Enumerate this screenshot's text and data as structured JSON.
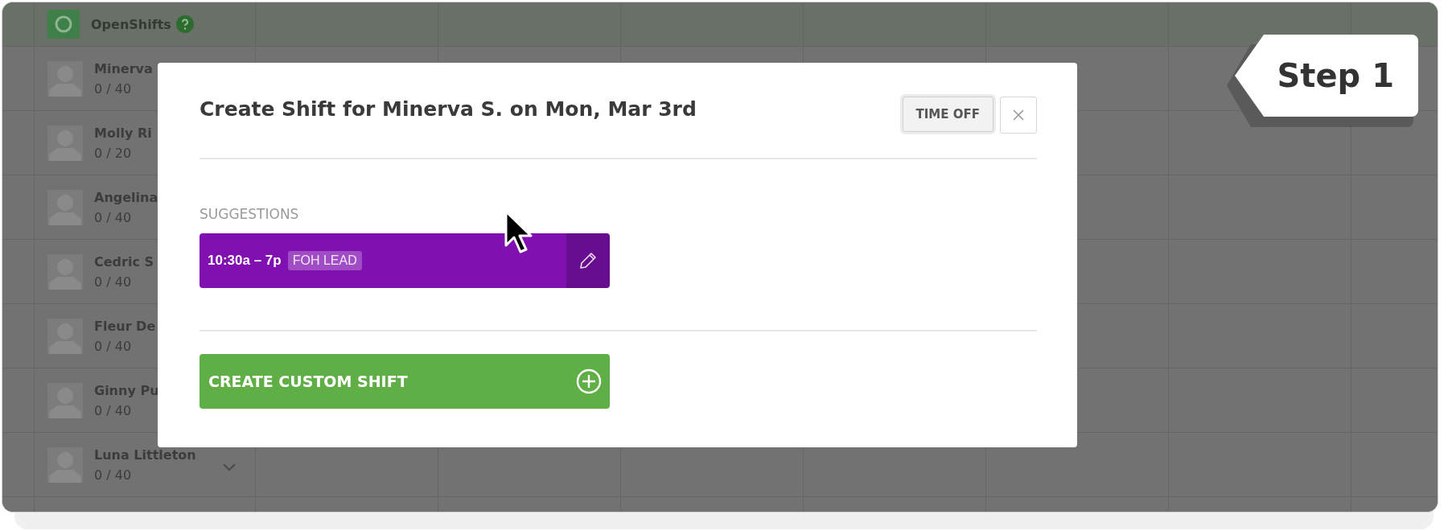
{
  "schedule": {
    "open_shifts": {
      "label": "OpenShifts"
    },
    "employees": [
      {
        "name": "Minerva",
        "hours": "0 / 40"
      },
      {
        "name": "Molly Ri",
        "hours": "0 / 20"
      },
      {
        "name": "Angelina",
        "hours": "0 / 40"
      },
      {
        "name": "Cedric S",
        "hours": "0 / 40"
      },
      {
        "name": "Fleur De",
        "hours": "0 / 40"
      },
      {
        "name": "Ginny Pu",
        "hours": "0 / 40"
      },
      {
        "name": "Luna Littleton",
        "hours": "0 / 40"
      }
    ]
  },
  "modal": {
    "title": "Create Shift for Minerva S. on Mon, Mar 3rd",
    "time_off_button": "TIME OFF",
    "section_label": "SUGGESTIONS",
    "suggestions": [
      {
        "time": "10:30a – 7p",
        "position": "FOH LEAD",
        "color": "#8010b0"
      }
    ],
    "create_button": "CREATE CUSTOM SHIFT"
  },
  "step_badge": {
    "label": "Step 1"
  }
}
